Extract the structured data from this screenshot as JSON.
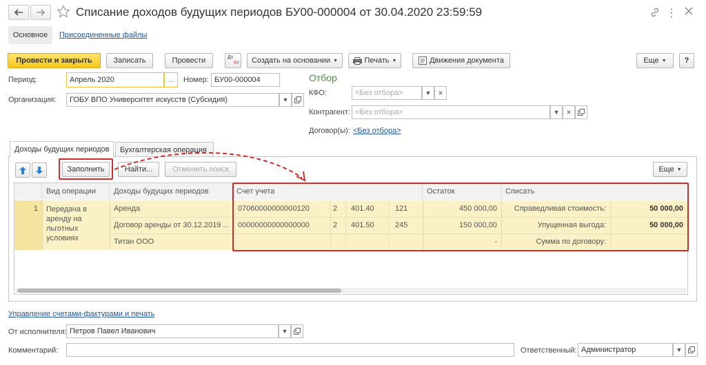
{
  "window": {
    "title": "Списание доходов будущих периодов БУ00-000004 от 30.04.2020 23:59:59"
  },
  "sections": {
    "main": "Основное",
    "attached": "Присоединенные файлы"
  },
  "toolbar": {
    "post_close": "Провести и закрыть",
    "save": "Записать",
    "post": "Провести",
    "dt_kt_top": "Дт",
    "dt_kt_bottom": "Кт",
    "create_based": "Создать на основании",
    "print": "Печать",
    "movements": "Движения документа",
    "more": "Еще",
    "help": "?"
  },
  "form": {
    "period_label": "Период:",
    "period_value": "Апрель 2020",
    "period_btn": "...",
    "number_label": "Номер:",
    "number_value": "БУ00-000004",
    "org_label": "Организация:",
    "org_value": "ГОБУ ВПО Университет искусств (Субсидия)"
  },
  "filter": {
    "title": "Отбор",
    "kfo_label": "КФО:",
    "kfo_placeholder": "<Без отбора>",
    "contractor_label": "Контрагент:",
    "contractor_placeholder": "<Без отбора>",
    "contract_label": "Договор(ы):",
    "contract_link": "<Без отбора>"
  },
  "tabs": {
    "income": "Доходы будущих периодов",
    "accounting": "Бухгалтерская операция"
  },
  "table_toolbar": {
    "fill": "Заполнить",
    "find": "Найти...",
    "cancel_search": "Отменить поиск",
    "more": "Еще"
  },
  "table": {
    "headers": {
      "op_type": "Вид операции",
      "income": "Доходы будущих периодов",
      "account": "Счет учета",
      "balance": "Остаток",
      "writeoff": "Списать"
    },
    "row": {
      "number": "1",
      "op_type_lines": [
        "Передача в",
        "аренду на",
        "льготных",
        "условиях"
      ],
      "income": [
        "Аренда",
        "Договор аренды от 30.12.2019 ...",
        "Титан ООО"
      ],
      "sublines": [
        {
          "account": "07060000000000120",
          "c1": "2",
          "c2": "401.40",
          "c3": "121",
          "balance": "450 000,00",
          "label": "Справедливая стоимость:",
          "amount": "50 000,00"
        },
        {
          "account": "00000000000000000",
          "c1": "2",
          "c2": "401.50",
          "c3": "245",
          "balance": "150 000,00",
          "label": "Упущенная выгода:",
          "amount": "50 000,00"
        },
        {
          "account": "",
          "c1": "",
          "c2": "",
          "c3": "",
          "balance": "-",
          "label": "Сумма по договору:",
          "amount": ""
        }
      ]
    }
  },
  "footer": {
    "invoices_link": "Управление счетами-фактурами и печать",
    "executor_label": "От исполнителя:",
    "executor_value": "Петров Павел Иванович",
    "comment_label": "Комментарий:",
    "comment_value": "",
    "responsible_label": "Ответственный:",
    "responsible_value": "Администратор"
  }
}
